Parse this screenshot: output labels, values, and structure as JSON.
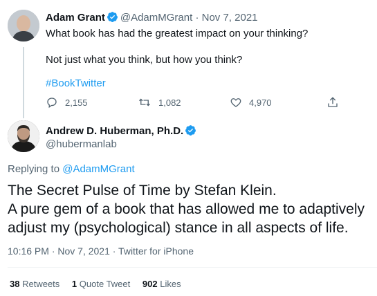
{
  "tweet1": {
    "author_name": "Adam Grant",
    "handle": "@AdamMGrant",
    "separator": "·",
    "date": "Nov 7, 2021",
    "text_line1": "What book has had the greatest impact on your thinking?",
    "text_line2": "Not just what you think, but how you think?",
    "hashtag": "#BookTwitter",
    "replies": "2,155",
    "retweets": "1,082",
    "likes": "4,970"
  },
  "tweet2": {
    "author_name": "Andrew D. Huberman, Ph.D.",
    "handle": "@hubermanlab",
    "replying_to_label": "Replying to",
    "replying_to_handle": "@AdamMGrant",
    "text_line1": "The Secret Pulse of Time by Stefan Klein.",
    "text_line2": "A pure gem of a book that has allowed me to adaptively",
    "text_line3": "adjust my (psychological) stance in all aspects of life.",
    "timestamp": "10:16 PM · Nov 7, 2021 · Twitter for iPhone",
    "stats": {
      "retweets_count": "38",
      "retweets_label": "Retweets",
      "quote_count": "1",
      "quote_label": "Quote Tweet",
      "likes_count": "902",
      "likes_label": "Likes"
    }
  },
  "colors": {
    "accent": "#1d9bf0",
    "muted": "#536471",
    "text": "#0f1419"
  },
  "icons": [
    "verified-badge-icon",
    "reply-icon",
    "retweet-icon",
    "like-icon",
    "share-icon"
  ]
}
